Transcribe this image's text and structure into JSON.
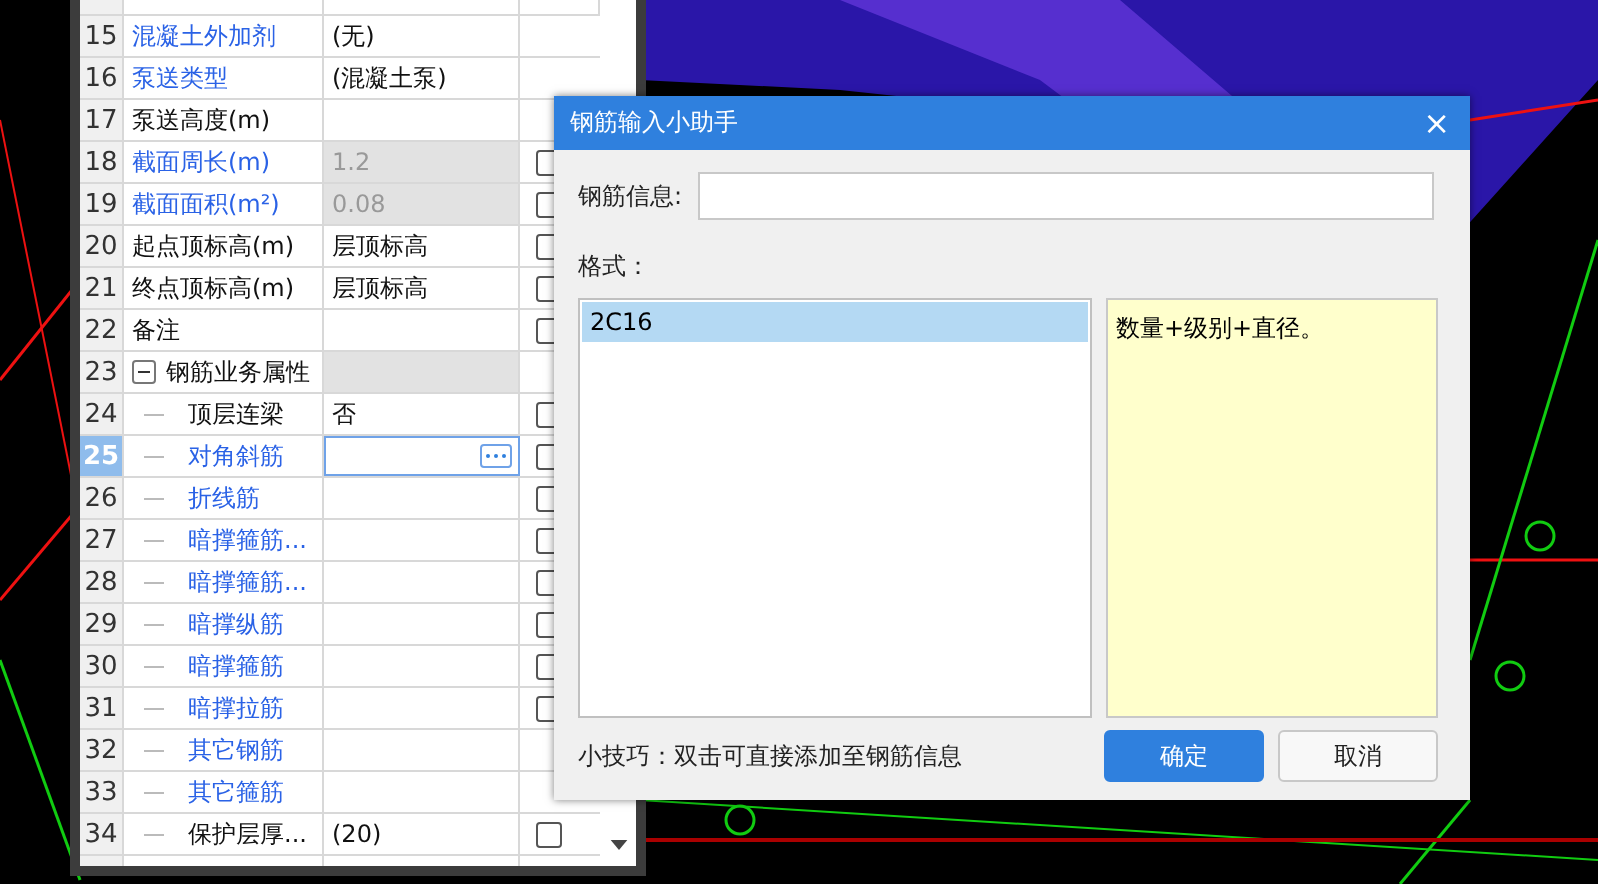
{
  "property_grid": {
    "rows": [
      {
        "number": "15",
        "name": "混凝土外加剂",
        "value": "(无)",
        "linked": true,
        "disabled": false,
        "selected": false
      },
      {
        "number": "16",
        "name": "泵送类型",
        "value": "(混凝土泵)",
        "linked": true,
        "disabled": false,
        "selected": false
      },
      {
        "number": "17",
        "name": "泵送高度(m)",
        "linked": false,
        "disabled": false,
        "selected": false
      },
      {
        "number": "18",
        "name": "截面周长(m)",
        "value": "1.2",
        "linked": true,
        "disabled": true,
        "selected": false,
        "checked": false
      },
      {
        "number": "19",
        "name": "截面面积(m²)",
        "value": "0.08",
        "linked": true,
        "disabled": true,
        "selected": false,
        "checked": false
      },
      {
        "number": "20",
        "name": "起点顶标高(m)",
        "value": "层顶标高",
        "linked": false,
        "disabled": false,
        "selected": false,
        "checked": false
      },
      {
        "number": "21",
        "name": "终点顶标高(m)",
        "value": "层顶标高",
        "linked": false,
        "disabled": false,
        "selected": false,
        "checked": false
      },
      {
        "number": "22",
        "name": "备注",
        "linked": false,
        "disabled": false,
        "selected": false,
        "checked": false
      },
      {
        "number": "23",
        "name": "钢筋业务属性",
        "linked": false,
        "disabled": true,
        "selected": false,
        "expanded": true,
        "children": [
          {
            "number": "24",
            "name": "顶层连梁",
            "value": "否",
            "linked": false,
            "disabled": false,
            "selected": false,
            "checked": false
          },
          {
            "number": "25",
            "name": "对角斜筋",
            "linked": true,
            "disabled": false,
            "selected": true,
            "checked": false
          },
          {
            "number": "26",
            "name": "折线筋",
            "linked": true,
            "disabled": false,
            "selected": false,
            "checked": false
          },
          {
            "number": "27",
            "name": "暗撑箍筋...",
            "linked": true,
            "disabled": false,
            "selected": false,
            "checked": false
          },
          {
            "number": "28",
            "name": "暗撑箍筋...",
            "linked": true,
            "disabled": false,
            "selected": false,
            "checked": false
          },
          {
            "number": "29",
            "name": "暗撑纵筋",
            "linked": true,
            "disabled": false,
            "selected": false,
            "checked": false
          },
          {
            "number": "30",
            "name": "暗撑箍筋",
            "linked": true,
            "disabled": false,
            "selected": false,
            "checked": false
          },
          {
            "number": "31",
            "name": "暗撑拉筋",
            "linked": true,
            "disabled": false,
            "selected": false,
            "checked": false
          },
          {
            "number": "32",
            "name": "其它钢筋",
            "linked": true,
            "disabled": false,
            "selected": false
          },
          {
            "number": "33",
            "name": "其它箍筋",
            "linked": true,
            "disabled": false,
            "selected": false
          },
          {
            "number": "34",
            "name": "保护层厚...",
            "value": "(20)",
            "linked": false,
            "disabled": false,
            "selected": false,
            "checked": false
          }
        ]
      }
    ]
  },
  "dialog": {
    "title": "钢筋输入小助手",
    "close": "×",
    "info_label": "钢筋信息:",
    "format_label": "格式：",
    "formats": [
      {
        "text": "2C16",
        "selected": true
      }
    ],
    "description": "数量+级别+直径。",
    "tip": "小技巧：双击可直接添加至钢筋信息",
    "buttons": [
      {
        "label": "确定",
        "kind": "primary"
      },
      {
        "label": "取消",
        "kind": "secondary"
      }
    ]
  }
}
